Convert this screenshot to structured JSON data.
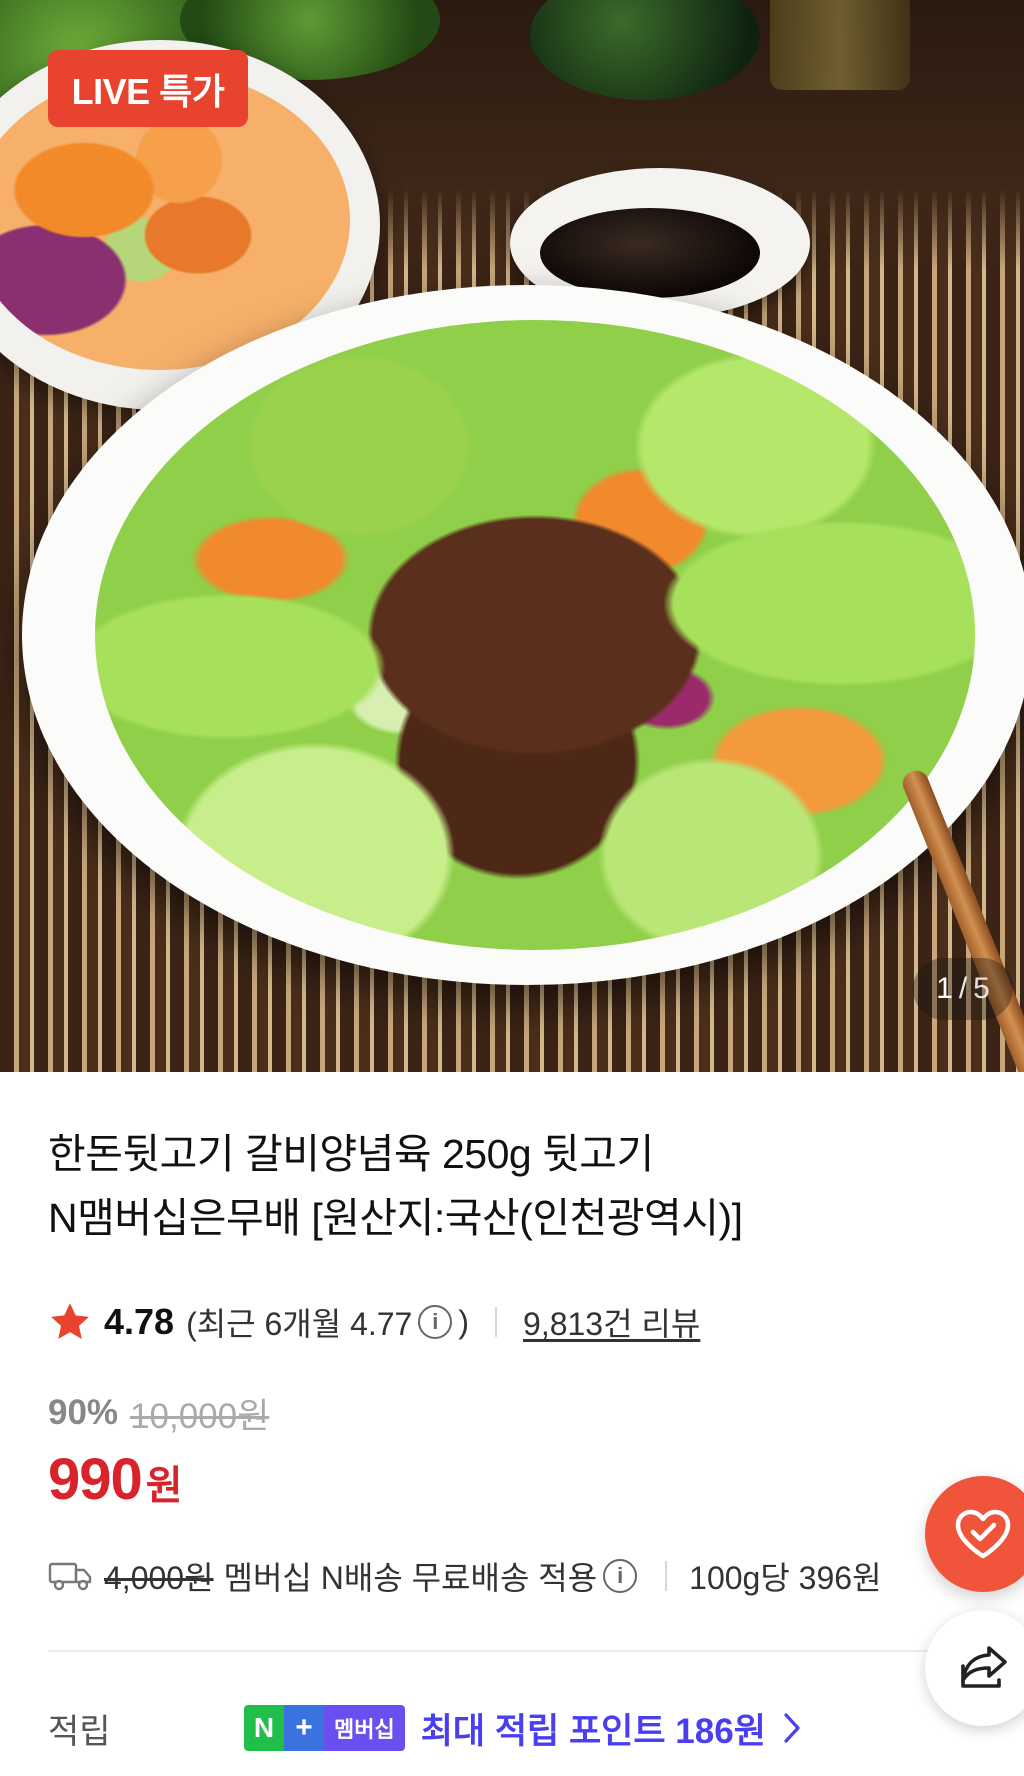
{
  "hero": {
    "badge": "LIVE 특가",
    "counter_current": "1",
    "counter_separator": "/",
    "counter_total": "5"
  },
  "product": {
    "title_line1": "한돈뒷고기 갈비양념육 250g 뒷고기",
    "title_line2": "N맴버십은무배 [원산지:국산(인천광역시)]"
  },
  "rating": {
    "value": "4.78",
    "recent_label": "(최근 6개월 4.77",
    "recent_close": ")",
    "info_glyph": "i",
    "reviews_link": "9,813건 리뷰"
  },
  "price": {
    "discount": "90%",
    "original": "10,000원",
    "final": "990",
    "unit": "원"
  },
  "shipping": {
    "fee_strike": "4,000원",
    "text": "멤버십 N배송 무료배송 적용",
    "info_glyph": "i",
    "unit_price": "100g당 396원"
  },
  "points": {
    "label": "적립",
    "badge_n": "N",
    "badge_plus": "+",
    "badge_member": "멤버십",
    "text": "최대 적립 포인트 186원"
  },
  "colors": {
    "accent_red": "#d8232a",
    "badge_red": "#e8432f",
    "points_purple": "#4a3ff0",
    "fab_like": "#f0543a"
  },
  "icons": {
    "star": "star-icon",
    "info": "info-icon",
    "truck": "truck-icon",
    "chevron": "chevron-right-icon",
    "like": "heart-check-icon",
    "share": "share-icon"
  }
}
